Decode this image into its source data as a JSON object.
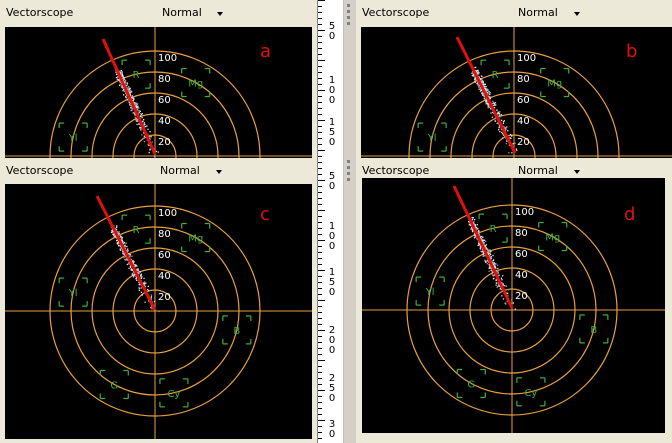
{
  "panels": [
    {
      "id": "a",
      "title": "Vectorscope",
      "mode": "Normal",
      "letter": "a"
    },
    {
      "id": "b",
      "title": "Vectorscope",
      "mode": "Normal",
      "letter": "b"
    },
    {
      "id": "c",
      "title": "Vectorscope",
      "mode": "Normal",
      "letter": "c"
    },
    {
      "id": "d",
      "title": "Vectorscope",
      "mode": "Normal",
      "letter": "d"
    }
  ],
  "ring_labels": [
    "20",
    "40",
    "60",
    "80",
    "100"
  ],
  "targets_top": [
    "R",
    "Mg",
    "Yl"
  ],
  "targets_full": [
    "R",
    "Mg",
    "Yl",
    "B",
    "G",
    "Cy"
  ],
  "ruler_labels": [
    "5\n0",
    "1\n0\n0",
    "1\n5\n0",
    "5\n0",
    "1\n0\n0",
    "1\n5\n0",
    "2\n0\n0",
    "2\n5\n0",
    "3\n0"
  ],
  "colors": {
    "scope_bg": "#000000",
    "graticule": "#e8a040",
    "target": "#40b040",
    "trace": "#e01010",
    "letter": "#e01010"
  }
}
